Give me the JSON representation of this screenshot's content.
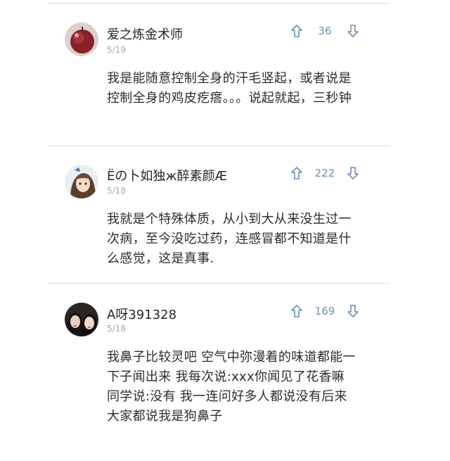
{
  "comments": [
    {
      "username": "爱之炼金术师",
      "date": "5/19",
      "votes": "36",
      "text": "我是能随意控制全身的汗毛竖起，或者说是控制全身的鸡皮疙瘩。。。说起就起，三秒钟",
      "avatar_icon": "apple-photo-avatar"
    },
    {
      "username": "Ёの卜如独ж醉素颜Æ",
      "date": "5/18",
      "votes": "222",
      "text": "我就是个特殊体质，从小到大从来没生过一次病，至今没吃过药，连感冒都不知道是什么感觉，这是真事.",
      "avatar_icon": "anime-girl-avatar"
    },
    {
      "username": "A呀391328",
      "date": "5/18",
      "votes": "169",
      "text": "我鼻子比较灵吧 空气中弥漫着的味道都能一下子闻出来 我每次说:xxx你闻见了花香嘛 同学说:没有 我一连问好多人都说没有后来大家都说我是狗鼻子",
      "avatar_icon": "two-girls-photo-avatar"
    }
  ],
  "colors": {
    "vote_accent": "#6b8fb5",
    "divider": "#e9ecef"
  }
}
